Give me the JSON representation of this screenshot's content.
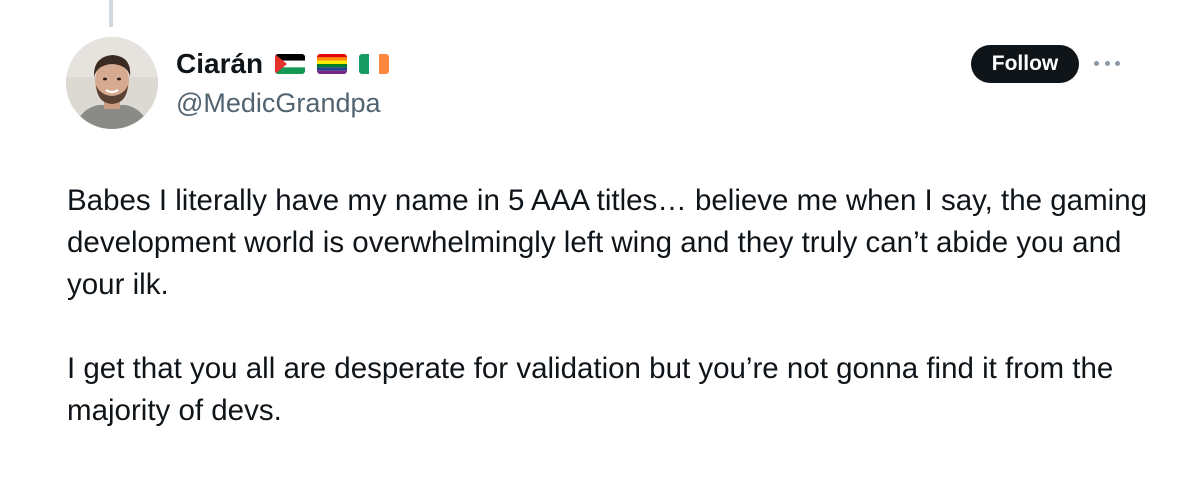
{
  "author": {
    "display_name": "Ciarán",
    "handle": "@MedicGrandpa",
    "flags": [
      "palestine-flag-icon",
      "rainbow-flag-icon",
      "ireland-flag-icon"
    ]
  },
  "actions": {
    "follow_label": "Follow",
    "more_icon": "more-horizontal-icon"
  },
  "tweet": {
    "paragraphs": [
      "Babes I literally have my name in 5 AAA titles… believe me when I say, the gaming development world is overwhelmingly left wing and they truly can’t abide you and your ilk.",
      "I get that you all are desperate for validation but you’re not gonna find it from the majority of devs."
    ]
  },
  "colors": {
    "text": "#0f1419",
    "secondary_text": "#536471",
    "button_bg": "#0f1419",
    "button_text": "#ffffff",
    "thread_line": "#cfd9de"
  }
}
